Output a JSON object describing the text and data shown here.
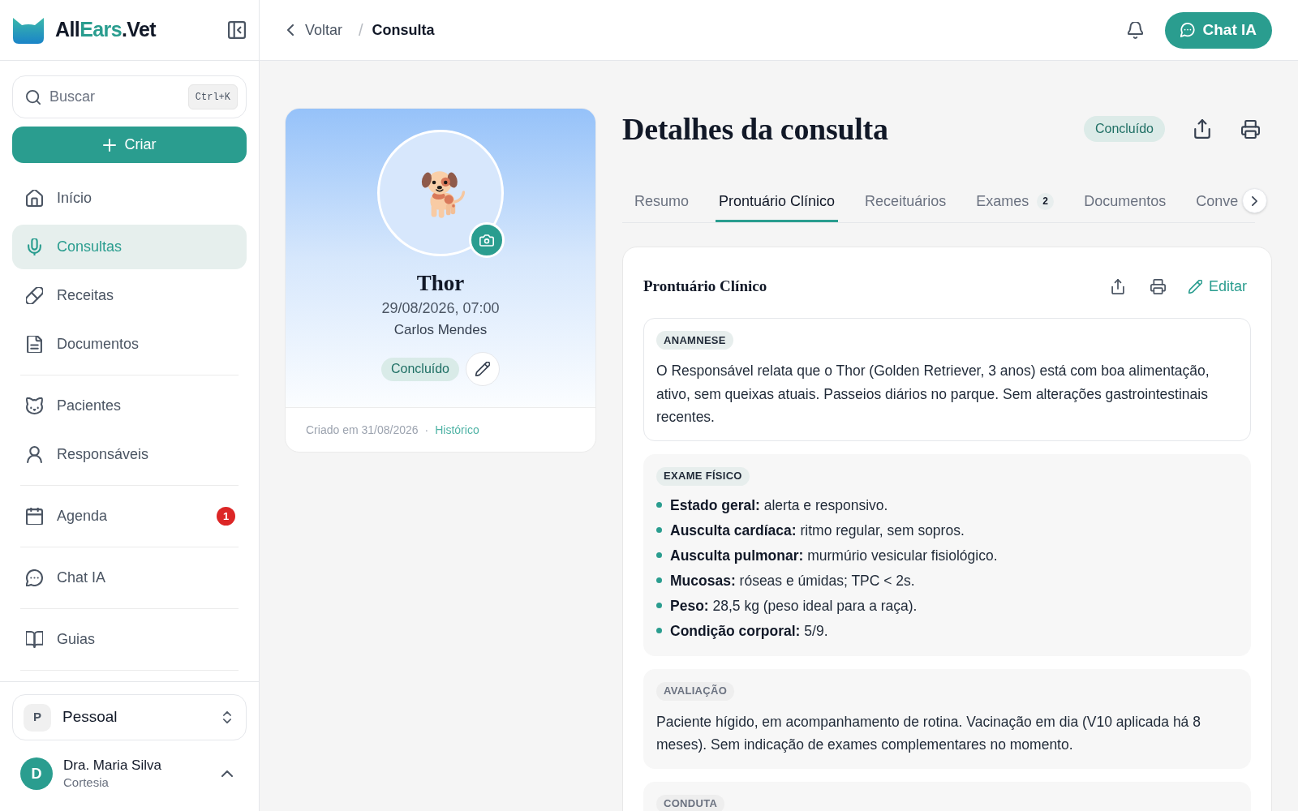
{
  "sidebar": {
    "brand": {
      "start": "All",
      "highlight": "Ears",
      "end": ".Vet"
    },
    "search": {
      "placeholder": "Buscar",
      "shortcut": "Ctrl+K"
    },
    "create_button": "Criar",
    "nav_groups": [
      [
        {
          "label": "Início",
          "selected": false
        },
        {
          "label": "Consultas",
          "selected": true
        },
        {
          "label": "Receitas",
          "selected": false
        },
        {
          "label": "Documentos",
          "selected": false
        }
      ],
      [
        {
          "label": "Pacientes",
          "selected": false
        },
        {
          "label": "Responsáveis",
          "selected": false
        }
      ],
      [
        {
          "label": "Agenda",
          "selected": false,
          "badge": "1"
        }
      ],
      [
        {
          "label": "Chat IA",
          "selected": false
        }
      ],
      [
        {
          "label": "Guias",
          "selected": false
        }
      ]
    ],
    "workspace": {
      "initial": "P",
      "label": "Pessoal"
    },
    "user": {
      "initial": "D",
      "name": "Dra. Maria Silva",
      "plan": "Cortesia"
    }
  },
  "topbar": {
    "breadcrumb": {
      "back": "Voltar",
      "separator": "/",
      "current": "Consulta"
    },
    "chat_button": "Chat IA"
  },
  "patient_card": {
    "name": "Thor",
    "datetime": "29/08/2026, 07:00",
    "owner": "Carlos Mendes",
    "status": "Concluído",
    "created": "Criado em 31/08/2026",
    "separator": "·",
    "history_link": "Histórico"
  },
  "details": {
    "title": "Detalhes da consulta",
    "status": "Concluído",
    "tabs": [
      {
        "label": "Resumo",
        "selected": false
      },
      {
        "label": "Prontuário Clínico",
        "selected": true
      },
      {
        "label": "Receituários",
        "selected": false
      },
      {
        "label": "Exames",
        "selected": false,
        "badge": "2"
      },
      {
        "label": "Documentos",
        "selected": false
      },
      {
        "label": "Conve",
        "selected": false
      }
    ],
    "record": {
      "title": "Prontuário Clínico",
      "edit_button": "Editar",
      "sections": [
        {
          "kind": "text",
          "label": "ANAMNESE",
          "highlighted": true,
          "muted": false,
          "text": "O Responsável relata que o Thor (Golden Retriever, 3 anos) está com boa alimentação, ativo, sem queixas atuais. Passeios diários no parque. Sem alterações gastrointestinais recentes."
        },
        {
          "kind": "list",
          "label": "EXAME FÍSICO",
          "highlighted": false,
          "muted": false,
          "items": [
            "**Estado geral:** alerta e responsivo.",
            "**Ausculta cardíaca:** ritmo regular, sem sopros.",
            "**Ausculta pulmonar:** murmúrio vesicular fisiológico.",
            "**Mucosas:** róseas e úmidas; TPC < 2s.",
            "**Peso:** 28,5 kg (peso ideal para a raça).",
            "**Condição corporal:** 5/9."
          ]
        },
        {
          "kind": "text",
          "label": "AVALIAÇÃO",
          "highlighted": false,
          "muted": true,
          "text": "Paciente hígido, em acompanhamento de rotina. Vacinação em dia (V10 aplicada há 8 meses). Sem indicação de exames complementares no momento."
        },
        {
          "kind": "text",
          "label": "CONDUTA",
          "highlighted": false,
          "muted": true
        }
      ]
    }
  }
}
